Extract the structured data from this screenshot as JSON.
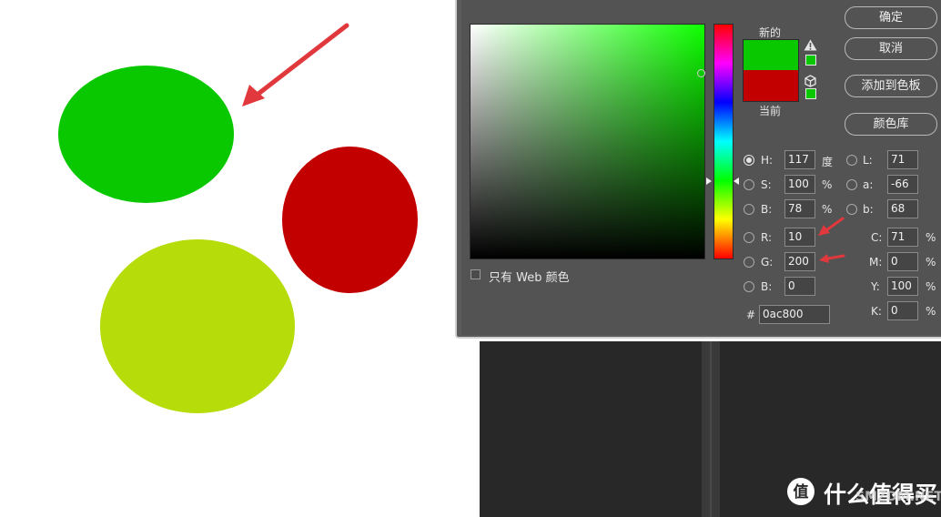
{
  "colors": {
    "new_color": "#0ac800",
    "current_color": "#c30000",
    "ellipse_green": "#0ac800",
    "ellipse_red": "#c30000",
    "ellipse_yellowgreen": "#b6dc0a",
    "annotation_arrow": "#e0383c",
    "dialog_background": "#535353"
  },
  "color_picker": {
    "new_label": "新的",
    "current_label": "当前",
    "web_only_label": "只有 Web 颜色",
    "web_only_checked": false,
    "buttons": {
      "ok": "确定",
      "cancel": "取消",
      "add_to_swatches": "添加到色板",
      "color_libraries": "颜色库"
    },
    "hsb": {
      "h_label": "H:",
      "h_value": "117",
      "h_unit": "度",
      "s_label": "S:",
      "s_value": "100",
      "s_unit": "%",
      "b_label": "B:",
      "b_value": "78",
      "b_unit": "%",
      "selected": "H"
    },
    "rgb": {
      "r_label": "R:",
      "r_value": "10",
      "g_label": "G:",
      "g_value": "200",
      "b_label": "B:",
      "b_value": "0"
    },
    "lab": {
      "l_label": "L:",
      "l_value": "71",
      "a_label": "a:",
      "a_value": "-66",
      "b_label": "b:",
      "b_value": "68"
    },
    "cmyk": {
      "c_label": "C:",
      "c_value": "71",
      "m_label": "M:",
      "m_value": "0",
      "y_label": "Y:",
      "y_value": "100",
      "k_label": "K:",
      "k_value": "0",
      "unit": "%"
    },
    "hex_label": "#",
    "hex_value": "0ac800"
  },
  "icons": {
    "gamut_warning": "warning-triangle-icon",
    "web_safe": "cube-icon"
  },
  "watermark": {
    "text": "什么值得买",
    "url": "SMZDM.NET",
    "logo_glyph": "值"
  }
}
